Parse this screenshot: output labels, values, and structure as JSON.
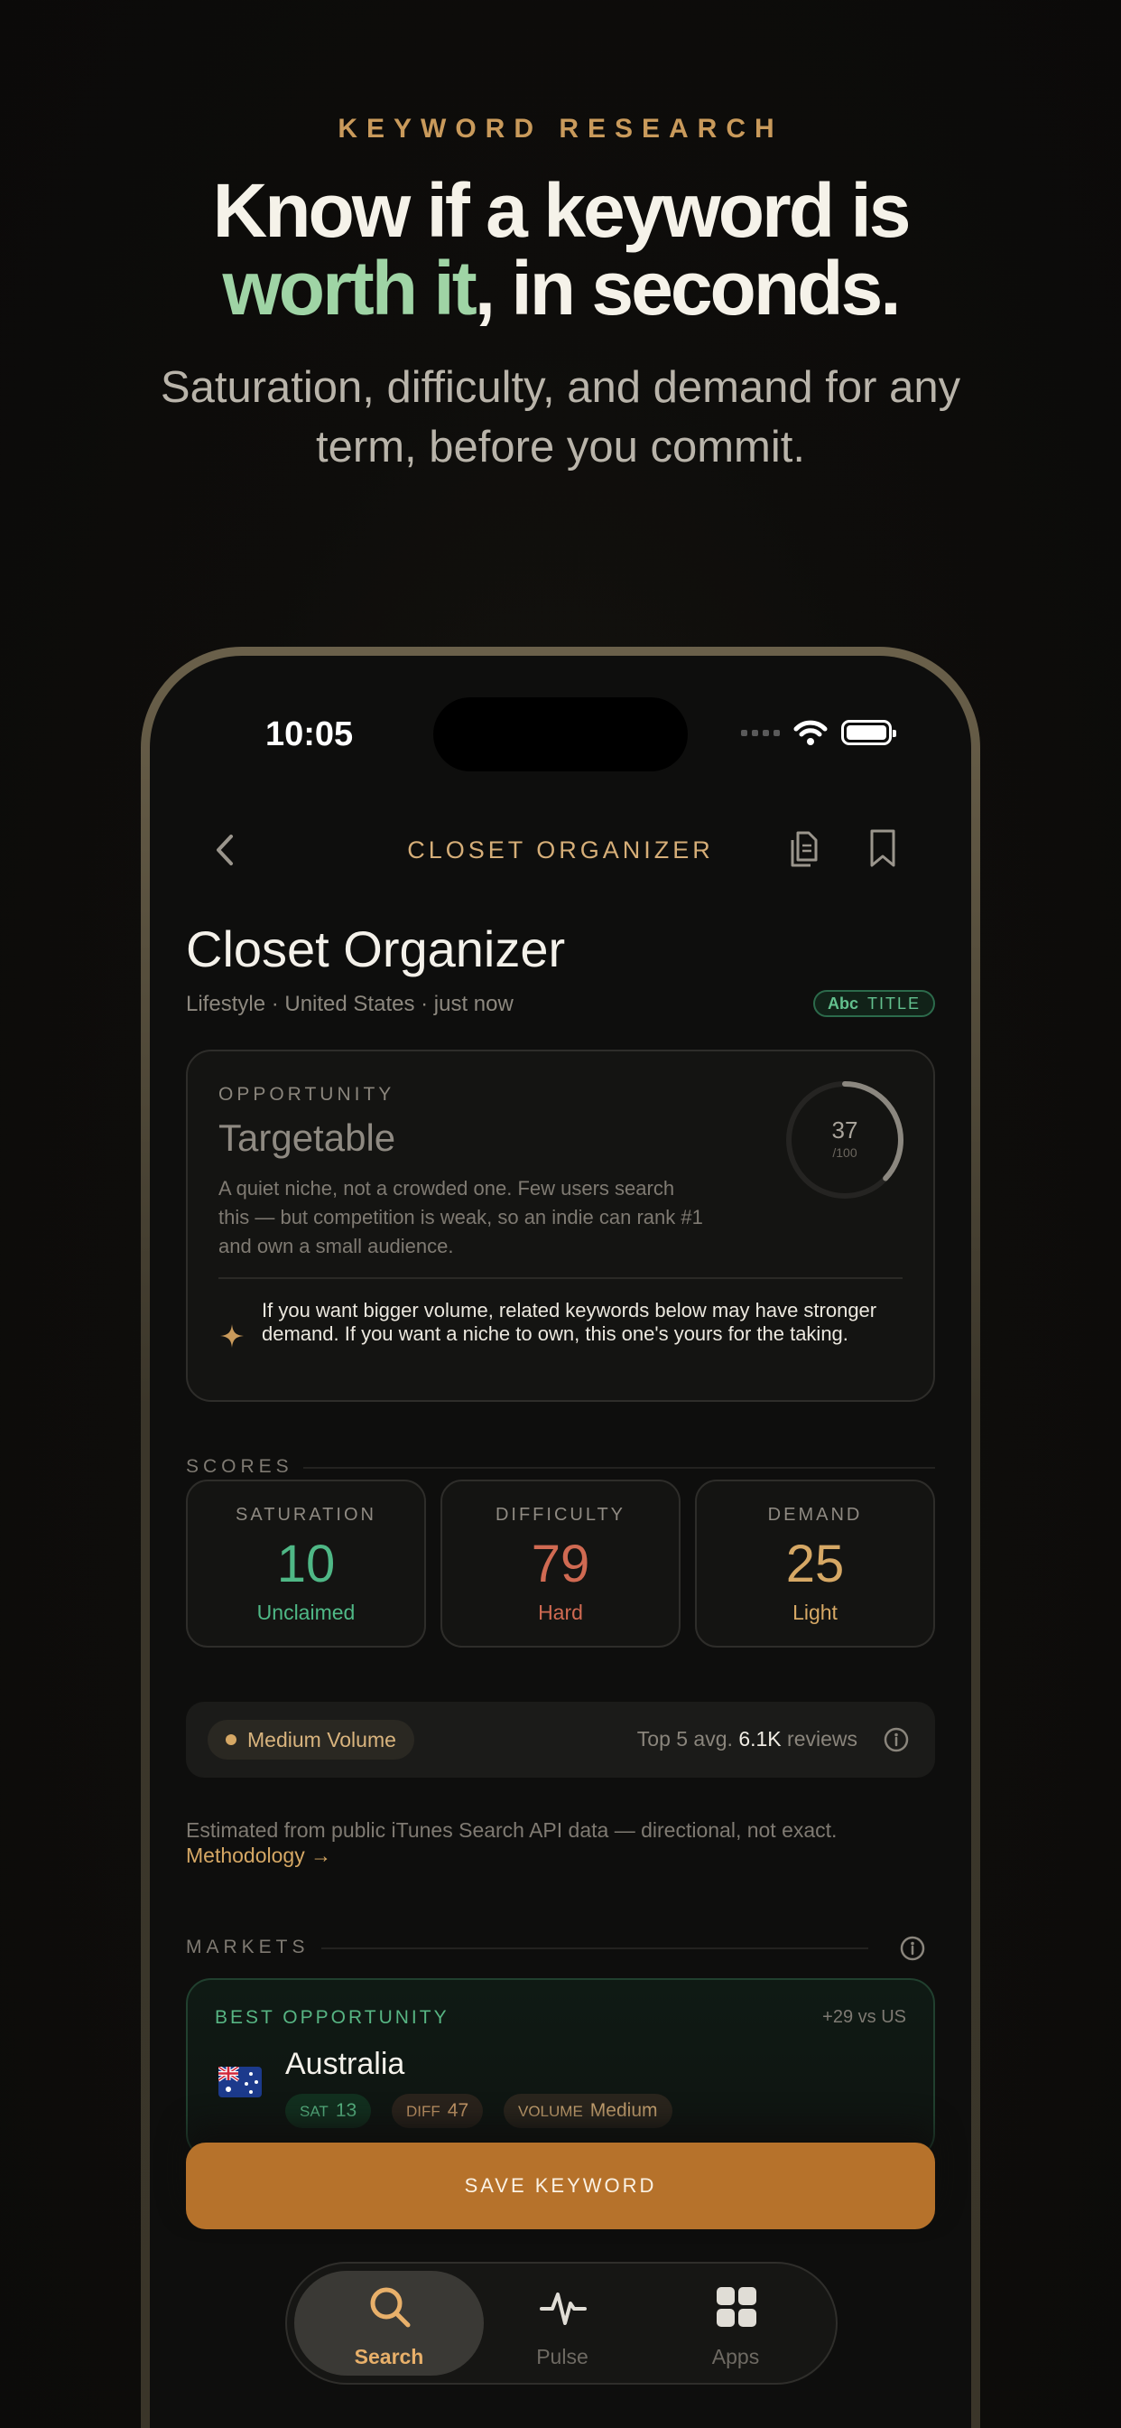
{
  "hero": {
    "eyebrow": "KEYWORD RESEARCH",
    "headline_line1": "Know if a keyword is",
    "headline_accent": "worth it",
    "headline_rest": ", in seconds.",
    "subhead": "Saturation, difficulty, and demand for any term, before you commit."
  },
  "status_bar": {
    "time": "10:05"
  },
  "nav": {
    "title": "CLOSET ORGANIZER"
  },
  "keyword": {
    "name": "Closet Organizer",
    "meta": "Lifestyle · United States · just now",
    "badge_abc": "Abc",
    "badge_label": "TITLE"
  },
  "opportunity": {
    "eyebrow": "OPPORTUNITY",
    "status": "Targetable",
    "description": "A quiet niche, not a crowded one. Few users search this — but competition is weak, so an indie can rank #1 and own a small audience.",
    "score": "37",
    "score_max": "/100",
    "tip": "If you want bigger volume, related keywords below may have stronger demand. If you want a niche to own, this one's yours for the taking."
  },
  "scores": {
    "heading": "SCORES",
    "items": [
      {
        "label": "SATURATION",
        "value": "10",
        "word": "Unclaimed"
      },
      {
        "label": "DIFFICULTY",
        "value": "79",
        "word": "Hard"
      },
      {
        "label": "DEMAND",
        "value": "25",
        "word": "Light"
      }
    ]
  },
  "volume": {
    "pill": "Medium Volume",
    "prefix": "Top 5 avg.",
    "value": "6.1K",
    "suffix": "reviews"
  },
  "estimate": {
    "text": "Estimated from public iTunes Search API data — directional, not exact.",
    "link": "Methodology →"
  },
  "markets": {
    "heading": "MARKETS",
    "best": {
      "eyebrow": "BEST OPPORTUNITY",
      "delta": "+29 vs US",
      "country": "Australia",
      "sat_label": "SAT",
      "sat_value": "13",
      "diff_label": "DIFF",
      "diff_value": "47",
      "vol_label": "VOLUME",
      "vol_value": "Medium"
    }
  },
  "save_button": "SAVE KEYWORD",
  "tabs": [
    {
      "label": "Search",
      "icon": "search-icon",
      "active": true
    },
    {
      "label": "Pulse",
      "icon": "pulse-icon",
      "active": false
    },
    {
      "label": "Apps",
      "icon": "apps-grid-icon",
      "active": false
    }
  ],
  "colors": {
    "accent_green": "#9fd4a5",
    "gold": "#d6a865",
    "saturation": "#4fb886",
    "difficulty": "#d06a52",
    "demand": "#d6a865",
    "save_button": "#b6722b"
  }
}
